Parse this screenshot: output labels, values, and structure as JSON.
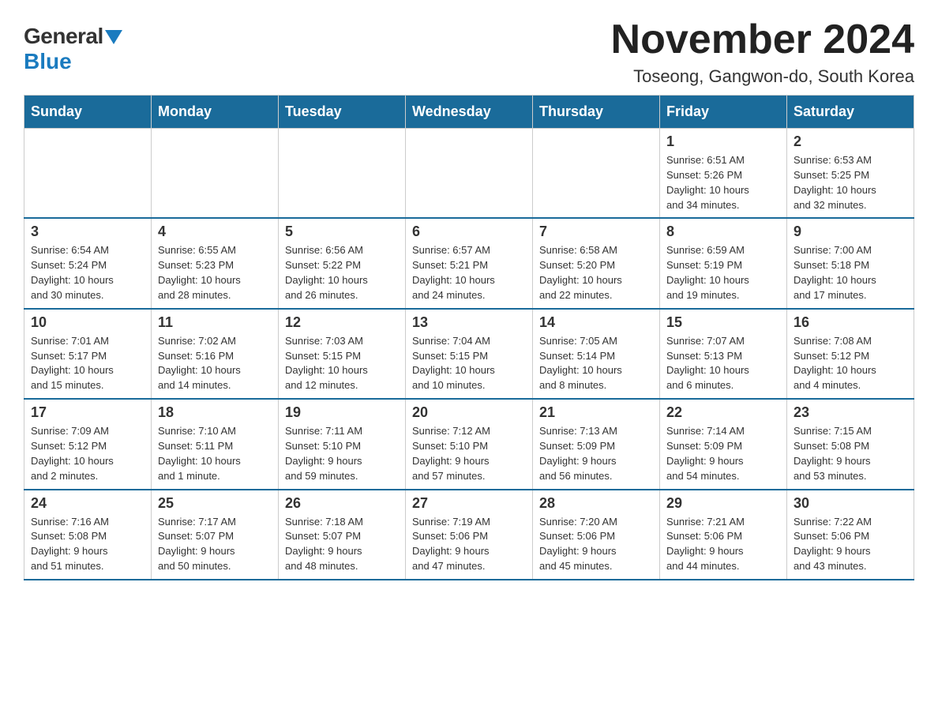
{
  "header": {
    "logo_general": "General",
    "logo_blue": "Blue",
    "main_title": "November 2024",
    "subtitle": "Toseong, Gangwon-do, South Korea"
  },
  "weekdays": [
    "Sunday",
    "Monday",
    "Tuesday",
    "Wednesday",
    "Thursday",
    "Friday",
    "Saturday"
  ],
  "weeks": [
    {
      "days": [
        {
          "num": "",
          "info": ""
        },
        {
          "num": "",
          "info": ""
        },
        {
          "num": "",
          "info": ""
        },
        {
          "num": "",
          "info": ""
        },
        {
          "num": "",
          "info": ""
        },
        {
          "num": "1",
          "info": "Sunrise: 6:51 AM\nSunset: 5:26 PM\nDaylight: 10 hours\nand 34 minutes."
        },
        {
          "num": "2",
          "info": "Sunrise: 6:53 AM\nSunset: 5:25 PM\nDaylight: 10 hours\nand 32 minutes."
        }
      ]
    },
    {
      "days": [
        {
          "num": "3",
          "info": "Sunrise: 6:54 AM\nSunset: 5:24 PM\nDaylight: 10 hours\nand 30 minutes."
        },
        {
          "num": "4",
          "info": "Sunrise: 6:55 AM\nSunset: 5:23 PM\nDaylight: 10 hours\nand 28 minutes."
        },
        {
          "num": "5",
          "info": "Sunrise: 6:56 AM\nSunset: 5:22 PM\nDaylight: 10 hours\nand 26 minutes."
        },
        {
          "num": "6",
          "info": "Sunrise: 6:57 AM\nSunset: 5:21 PM\nDaylight: 10 hours\nand 24 minutes."
        },
        {
          "num": "7",
          "info": "Sunrise: 6:58 AM\nSunset: 5:20 PM\nDaylight: 10 hours\nand 22 minutes."
        },
        {
          "num": "8",
          "info": "Sunrise: 6:59 AM\nSunset: 5:19 PM\nDaylight: 10 hours\nand 19 minutes."
        },
        {
          "num": "9",
          "info": "Sunrise: 7:00 AM\nSunset: 5:18 PM\nDaylight: 10 hours\nand 17 minutes."
        }
      ]
    },
    {
      "days": [
        {
          "num": "10",
          "info": "Sunrise: 7:01 AM\nSunset: 5:17 PM\nDaylight: 10 hours\nand 15 minutes."
        },
        {
          "num": "11",
          "info": "Sunrise: 7:02 AM\nSunset: 5:16 PM\nDaylight: 10 hours\nand 14 minutes."
        },
        {
          "num": "12",
          "info": "Sunrise: 7:03 AM\nSunset: 5:15 PM\nDaylight: 10 hours\nand 12 minutes."
        },
        {
          "num": "13",
          "info": "Sunrise: 7:04 AM\nSunset: 5:15 PM\nDaylight: 10 hours\nand 10 minutes."
        },
        {
          "num": "14",
          "info": "Sunrise: 7:05 AM\nSunset: 5:14 PM\nDaylight: 10 hours\nand 8 minutes."
        },
        {
          "num": "15",
          "info": "Sunrise: 7:07 AM\nSunset: 5:13 PM\nDaylight: 10 hours\nand 6 minutes."
        },
        {
          "num": "16",
          "info": "Sunrise: 7:08 AM\nSunset: 5:12 PM\nDaylight: 10 hours\nand 4 minutes."
        }
      ]
    },
    {
      "days": [
        {
          "num": "17",
          "info": "Sunrise: 7:09 AM\nSunset: 5:12 PM\nDaylight: 10 hours\nand 2 minutes."
        },
        {
          "num": "18",
          "info": "Sunrise: 7:10 AM\nSunset: 5:11 PM\nDaylight: 10 hours\nand 1 minute."
        },
        {
          "num": "19",
          "info": "Sunrise: 7:11 AM\nSunset: 5:10 PM\nDaylight: 9 hours\nand 59 minutes."
        },
        {
          "num": "20",
          "info": "Sunrise: 7:12 AM\nSunset: 5:10 PM\nDaylight: 9 hours\nand 57 minutes."
        },
        {
          "num": "21",
          "info": "Sunrise: 7:13 AM\nSunset: 5:09 PM\nDaylight: 9 hours\nand 56 minutes."
        },
        {
          "num": "22",
          "info": "Sunrise: 7:14 AM\nSunset: 5:09 PM\nDaylight: 9 hours\nand 54 minutes."
        },
        {
          "num": "23",
          "info": "Sunrise: 7:15 AM\nSunset: 5:08 PM\nDaylight: 9 hours\nand 53 minutes."
        }
      ]
    },
    {
      "days": [
        {
          "num": "24",
          "info": "Sunrise: 7:16 AM\nSunset: 5:08 PM\nDaylight: 9 hours\nand 51 minutes."
        },
        {
          "num": "25",
          "info": "Sunrise: 7:17 AM\nSunset: 5:07 PM\nDaylight: 9 hours\nand 50 minutes."
        },
        {
          "num": "26",
          "info": "Sunrise: 7:18 AM\nSunset: 5:07 PM\nDaylight: 9 hours\nand 48 minutes."
        },
        {
          "num": "27",
          "info": "Sunrise: 7:19 AM\nSunset: 5:06 PM\nDaylight: 9 hours\nand 47 minutes."
        },
        {
          "num": "28",
          "info": "Sunrise: 7:20 AM\nSunset: 5:06 PM\nDaylight: 9 hours\nand 45 minutes."
        },
        {
          "num": "29",
          "info": "Sunrise: 7:21 AM\nSunset: 5:06 PM\nDaylight: 9 hours\nand 44 minutes."
        },
        {
          "num": "30",
          "info": "Sunrise: 7:22 AM\nSunset: 5:06 PM\nDaylight: 9 hours\nand 43 minutes."
        }
      ]
    }
  ]
}
